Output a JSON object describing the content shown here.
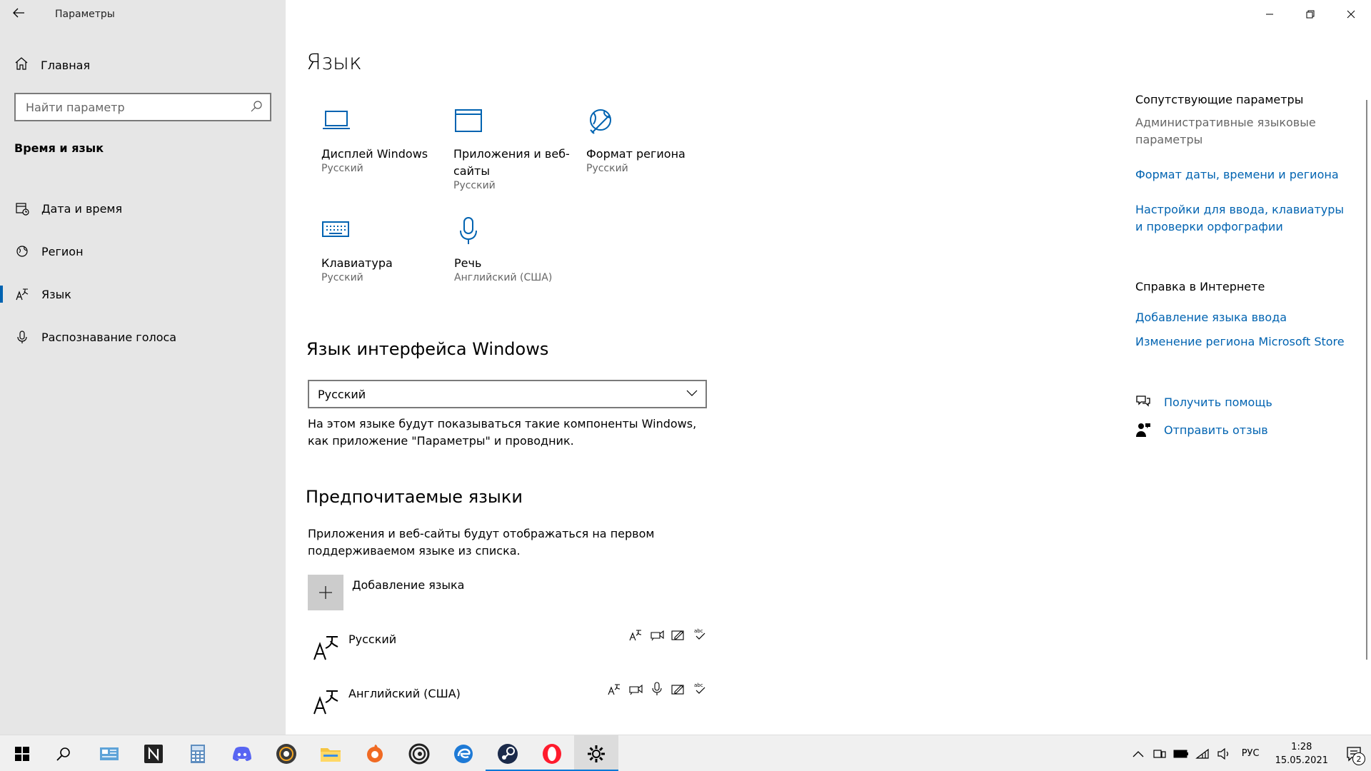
{
  "window": {
    "app_title": "Параметры",
    "minimize": "—",
    "maximize": "❐",
    "close": "✕"
  },
  "sidebar": {
    "home_label": "Главная",
    "search_placeholder": "Найти параметр",
    "section_title": "Время и язык",
    "items": [
      {
        "label": "Дата и время",
        "icon": "calendar-clock-icon"
      },
      {
        "label": "Регион",
        "icon": "globe-icon"
      },
      {
        "label": "Язык",
        "icon": "language-icon",
        "active": true
      },
      {
        "label": "Распознавание голоса",
        "icon": "microphone-icon"
      }
    ]
  },
  "main": {
    "title": "Язык",
    "tiles": [
      {
        "name": "Дисплей Windows",
        "sub": "Русский",
        "icon": "laptop-icon"
      },
      {
        "name": "Приложения и веб-сайты",
        "sub": "Русский",
        "icon": "browser-window-icon"
      },
      {
        "name": "Формат региона",
        "sub": "Русский",
        "icon": "globe-format-icon"
      },
      {
        "name": "Клавиатура",
        "sub": "Русский",
        "icon": "keyboard-icon"
      },
      {
        "name": "Речь",
        "sub": "Английский (США)",
        "icon": "microphone-icon"
      }
    ],
    "display_lang_heading": "Язык интерфейса Windows",
    "display_lang_value": "Русский",
    "display_lang_desc": "На этом языке будут показываться такие компоненты Windows, как приложение \"Параметры\" и проводник.",
    "preferred_heading": "Предпочитаемые языки",
    "preferred_desc": "Приложения и веб-сайты будут отображаться на первом поддерживаемом языке из списка.",
    "add_language": "Добавление языка",
    "languages": [
      {
        "name": "Русский",
        "features": [
          "display-language-icon",
          "text-to-speech-icon",
          "handwriting-icon",
          "spellcheck-icon"
        ]
      },
      {
        "name": "Английский (США)",
        "features": [
          "display-language-icon",
          "text-to-speech-icon",
          "speech-recognition-icon",
          "handwriting-icon",
          "spellcheck-icon"
        ]
      }
    ]
  },
  "rail": {
    "related_heading": "Сопутствующие параметры",
    "admin_text": "Административные языковые параметры",
    "link_format": "Формат даты, времени и региона",
    "link_typing": "Настройки для ввода, клавиатуры и проверки орфографии",
    "help_heading": "Справка в Интернете",
    "link_add_input": "Добавление языка ввода",
    "link_store_region": "Изменение региона Microsoft Store",
    "get_help": "Получить помощь",
    "feedback": "Отправить отзыв"
  },
  "taskbar": {
    "apps": [
      "windows-start-icon",
      "search-icon",
      "control-panel-icon",
      "notion-icon",
      "calculator-icon",
      "discord-icon",
      "music-player-icon",
      "file-explorer-icon",
      "browser-orange-icon",
      "ubisoft-icon",
      "edge-icon",
      "steam-icon",
      "opera-icon",
      "settings-icon"
    ],
    "lang": "РУС",
    "time": "1:28",
    "date": "15.05.2021",
    "notif_count": "2",
    "accent": "#0078d7"
  }
}
